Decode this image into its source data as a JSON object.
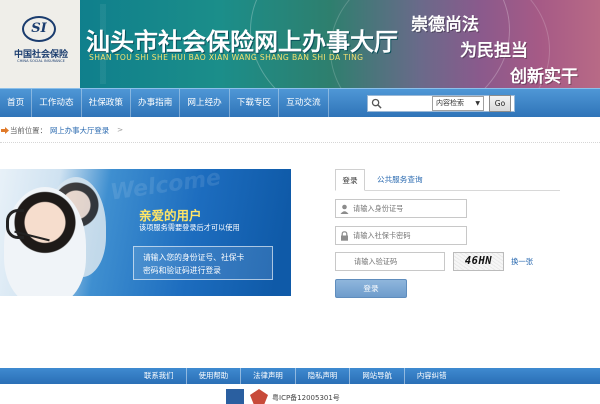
{
  "banner": {
    "logo_symbol": "SI",
    "logo_cn": "中国社会保险",
    "logo_en": "CHINA SOCIAL INSURANCE",
    "title_cn": "汕头市社会保险网上办事大厅",
    "title_en": "SHAN TOU SHI SHE HUI BAO XIAN WANG SHANG BAN SHI DA TING",
    "slogans": [
      "崇德尚法",
      "为民担当",
      "创新实干"
    ]
  },
  "nav": {
    "items": [
      {
        "label": "首页"
      },
      {
        "label": "工作动态"
      },
      {
        "label": "社保政策"
      },
      {
        "label": "办事指南"
      },
      {
        "label": "网上经办"
      },
      {
        "label": "下载专区"
      },
      {
        "label": "互动交流"
      }
    ],
    "search": {
      "value": "",
      "placeholder": ""
    },
    "search_scope": "内容检索",
    "go_label": "Go"
  },
  "breadcrumb": {
    "label": "当前位置：",
    "link": "网上办事大厅登录",
    "separator": ">"
  },
  "hero": {
    "title": "亲爱的用户",
    "subtitle": "该项服务需要登录后才可以使用",
    "instruction_line1": "请输入您的身份证号、社保卡",
    "instruction_line2": "密码和验证码进行登录"
  },
  "login": {
    "tabs": [
      {
        "label": "登录",
        "active": true
      },
      {
        "label": "公共服务查询",
        "active": false
      }
    ],
    "id_field": {
      "value": "",
      "placeholder": "请输入身份证号"
    },
    "password_field": {
      "value": "",
      "placeholder": "请输入社保卡密码"
    },
    "captcha_field": {
      "value": "",
      "placeholder": "请输入验证码"
    },
    "captcha_text": "46HN",
    "refresh_label": "换一张",
    "submit_label": "登录"
  },
  "footer": {
    "links": [
      {
        "label": "联系我们"
      },
      {
        "label": "使用帮助"
      },
      {
        "label": "法律声明"
      },
      {
        "label": "隐私声明"
      },
      {
        "label": "网站导航"
      },
      {
        "label": "内容纠错"
      }
    ],
    "icp": "粤ICP备12005301号"
  },
  "colors": {
    "nav_blue": "#3a82c6",
    "link_blue": "#2a6ab0",
    "hero_title_yellow": "#ffe566",
    "banner_teal": "#0f7f8c"
  }
}
